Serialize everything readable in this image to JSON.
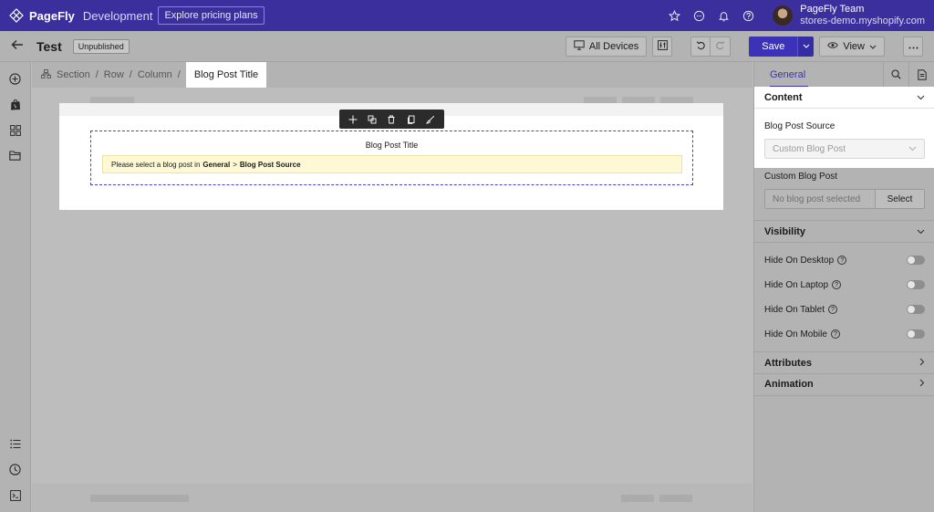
{
  "app": {
    "brand": "PageFly",
    "environment": "Development",
    "pricing_button": "Explore pricing plans"
  },
  "user": {
    "name": "PageFly Team",
    "store": "stores-demo.myshopify.com"
  },
  "toolbar": {
    "page_title": "Test",
    "status_badge": "Unpublished",
    "devices_label": "All Devices",
    "save_label": "Save",
    "view_label": "View"
  },
  "breadcrumb": {
    "items": [
      "Section",
      "Row",
      "Column"
    ],
    "active": "Blog Post Title"
  },
  "canvas": {
    "element_title": "Blog Post Title",
    "notice_prefix": "Please select a blog post in",
    "notice_general": "General",
    "notice_separator": ">",
    "notice_source": "Blog Post Source"
  },
  "panel": {
    "tab_general": "General",
    "content_section": "Content",
    "blog_post_source_label": "Blog Post Source",
    "blog_post_source_value": "Custom Blog Post",
    "custom_blog_post_label": "Custom Blog Post",
    "custom_blog_post_placeholder": "No blog post selected",
    "select_button": "Select",
    "visibility_section": "Visibility",
    "toggles": [
      {
        "label": "Hide On Desktop",
        "on": false
      },
      {
        "label": "Hide On Laptop",
        "on": false
      },
      {
        "label": "Hide On Tablet",
        "on": false
      },
      {
        "label": "Hide On Mobile",
        "on": false
      }
    ],
    "attributes_section": "Attributes",
    "animation_section": "Animation"
  },
  "colors": {
    "brand": "#3b2f9e",
    "primary": "#3b32b8",
    "notice_bg": "#fff8d5"
  }
}
